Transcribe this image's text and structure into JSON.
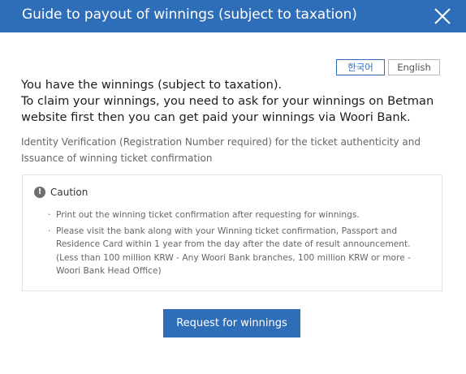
{
  "dialog": {
    "title": "Guide to payout of winnings (subject to taxation)",
    "close_icon": "close-icon"
  },
  "language": {
    "korean_label": "한국어",
    "english_label": "English",
    "selected": "한국어"
  },
  "intro": {
    "line1": "You have the winnings (subject to taxation).",
    "line2": "To claim your winnings, you need to ask for your winnings on Betman website first then you can get paid your winnings via Woori Bank.",
    "note": "Identity Verification (Registration Number required) for the ticket authenticity and Issuance of winning ticket confirmation"
  },
  "caution": {
    "icon": "exclamation-circle-icon",
    "title": "Caution",
    "items": [
      "Print out the winning ticket confirmation after requesting for winnings.",
      "Please visit the bank along with your Winning ticket confirmation, Passport and Residence Card within 1 year from the day after the date of result announcement. (Less than 100 million KRW - Any Woori Bank branches, 100 million KRW or more - Woori Bank Head Office)"
    ]
  },
  "actions": {
    "request_label": "Request for winnings"
  },
  "colors": {
    "primary": "#2e6db8",
    "text_dark": "#1d1d1d",
    "text_muted": "#666666"
  }
}
